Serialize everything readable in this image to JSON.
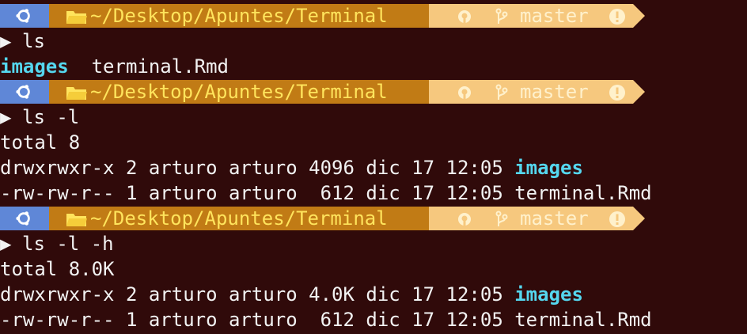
{
  "prompt": {
    "path": "~/Desktop/Apuntes/Terminal",
    "branch": "master",
    "colors": {
      "os_segment": "#5f87d7",
      "path_segment": "#c17b15",
      "path_text": "#ffe45c",
      "git_segment": "#f6c87e",
      "branch_text": "#fff1cc"
    },
    "icons": [
      "ubuntu-icon",
      "folder-icon",
      "github-icon",
      "branch-icon",
      "warning-icon"
    ]
  },
  "command_marker": "▶",
  "blocks": [
    {
      "command": "ls",
      "output": {
        "dir_name": "images",
        "file_name": "terminal.Rmd"
      }
    },
    {
      "command": "ls -l",
      "output": {
        "total": "total 8",
        "row1_meta": "drwxrwxr-x 2 arturo arturo 4096 dic 17 12:05 ",
        "row1_name": "images",
        "row2_meta": "-rw-rw-r-- 1 arturo arturo  612 dic 17 12:05 ",
        "row2_name": "terminal.Rmd"
      }
    },
    {
      "command": "ls -l -h",
      "output": {
        "total": "total 8.0K",
        "row1_meta": "drwxrwxr-x 2 arturo arturo 4.0K dic 17 12:05 ",
        "row1_name": "images",
        "row2_meta": "-rw-rw-r-- 1 arturo arturo  612 dic 17 12:05 ",
        "row2_name": "terminal.Rmd"
      }
    }
  ],
  "theme": {
    "background": "#300a0a",
    "foreground": "#f2f2f2",
    "directory": "#55d7ef"
  }
}
